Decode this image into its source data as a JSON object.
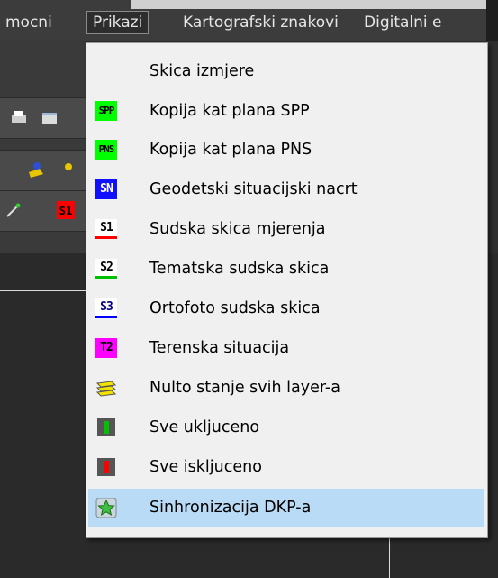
{
  "menubar": {
    "items": [
      "mocni",
      "Prikazi",
      "Kartografski znakovi",
      "Digitalni e"
    ]
  },
  "menu": {
    "items": [
      {
        "label": "Skica izmjere",
        "icon": "none"
      },
      {
        "label": "Kopija kat plana SPP",
        "icon": "spp-icon",
        "badge": "SPP",
        "bg": "#00ff00",
        "fg": "#000000"
      },
      {
        "label": "Kopija kat plana PNS",
        "icon": "pns-icon",
        "badge": "PNS",
        "bg": "#00ff00",
        "fg": "#000000"
      },
      {
        "label": "Geodetski situacijski nacrt",
        "icon": "sn-icon",
        "badge": "SN",
        "bg": "#1010ff",
        "fg": "#ffffff"
      },
      {
        "label": "Sudska skica mjerenja",
        "icon": "s1-icon",
        "badge": "S1",
        "bg": "#ffffff",
        "fg": "#000000",
        "accent": "#ff0000"
      },
      {
        "label": "Tematska sudska skica",
        "icon": "s2-icon",
        "badge": "S2",
        "bg": "#ffffff",
        "fg": "#000000",
        "accent": "#00c000"
      },
      {
        "label": "Ortofoto sudska skica",
        "icon": "s3-icon",
        "badge": "S3",
        "bg": "#ffffff",
        "fg": "#000080",
        "accent": "#0000ff"
      },
      {
        "label": "Terenska situacija",
        "icon": "t2-icon",
        "badge": "T2",
        "bg": "#ff00ff",
        "fg": "#000000"
      },
      {
        "label": "Nulto stanje svih layer-a",
        "icon": "layers-icon"
      },
      {
        "label": "Sve ukljuceno",
        "icon": "all-on-icon",
        "accent": "#00c000"
      },
      {
        "label": "Sve iskljuceno",
        "icon": "all-off-icon",
        "accent": "#ff0000"
      },
      {
        "label": "Sinhronizacija DKP-a",
        "icon": "sync-star-icon",
        "highlighted": true
      }
    ]
  },
  "colors": {
    "highlight": "#b9dbf5",
    "menu_bg": "#f0f0f0",
    "menubar_bg": "#3c3c3c"
  }
}
